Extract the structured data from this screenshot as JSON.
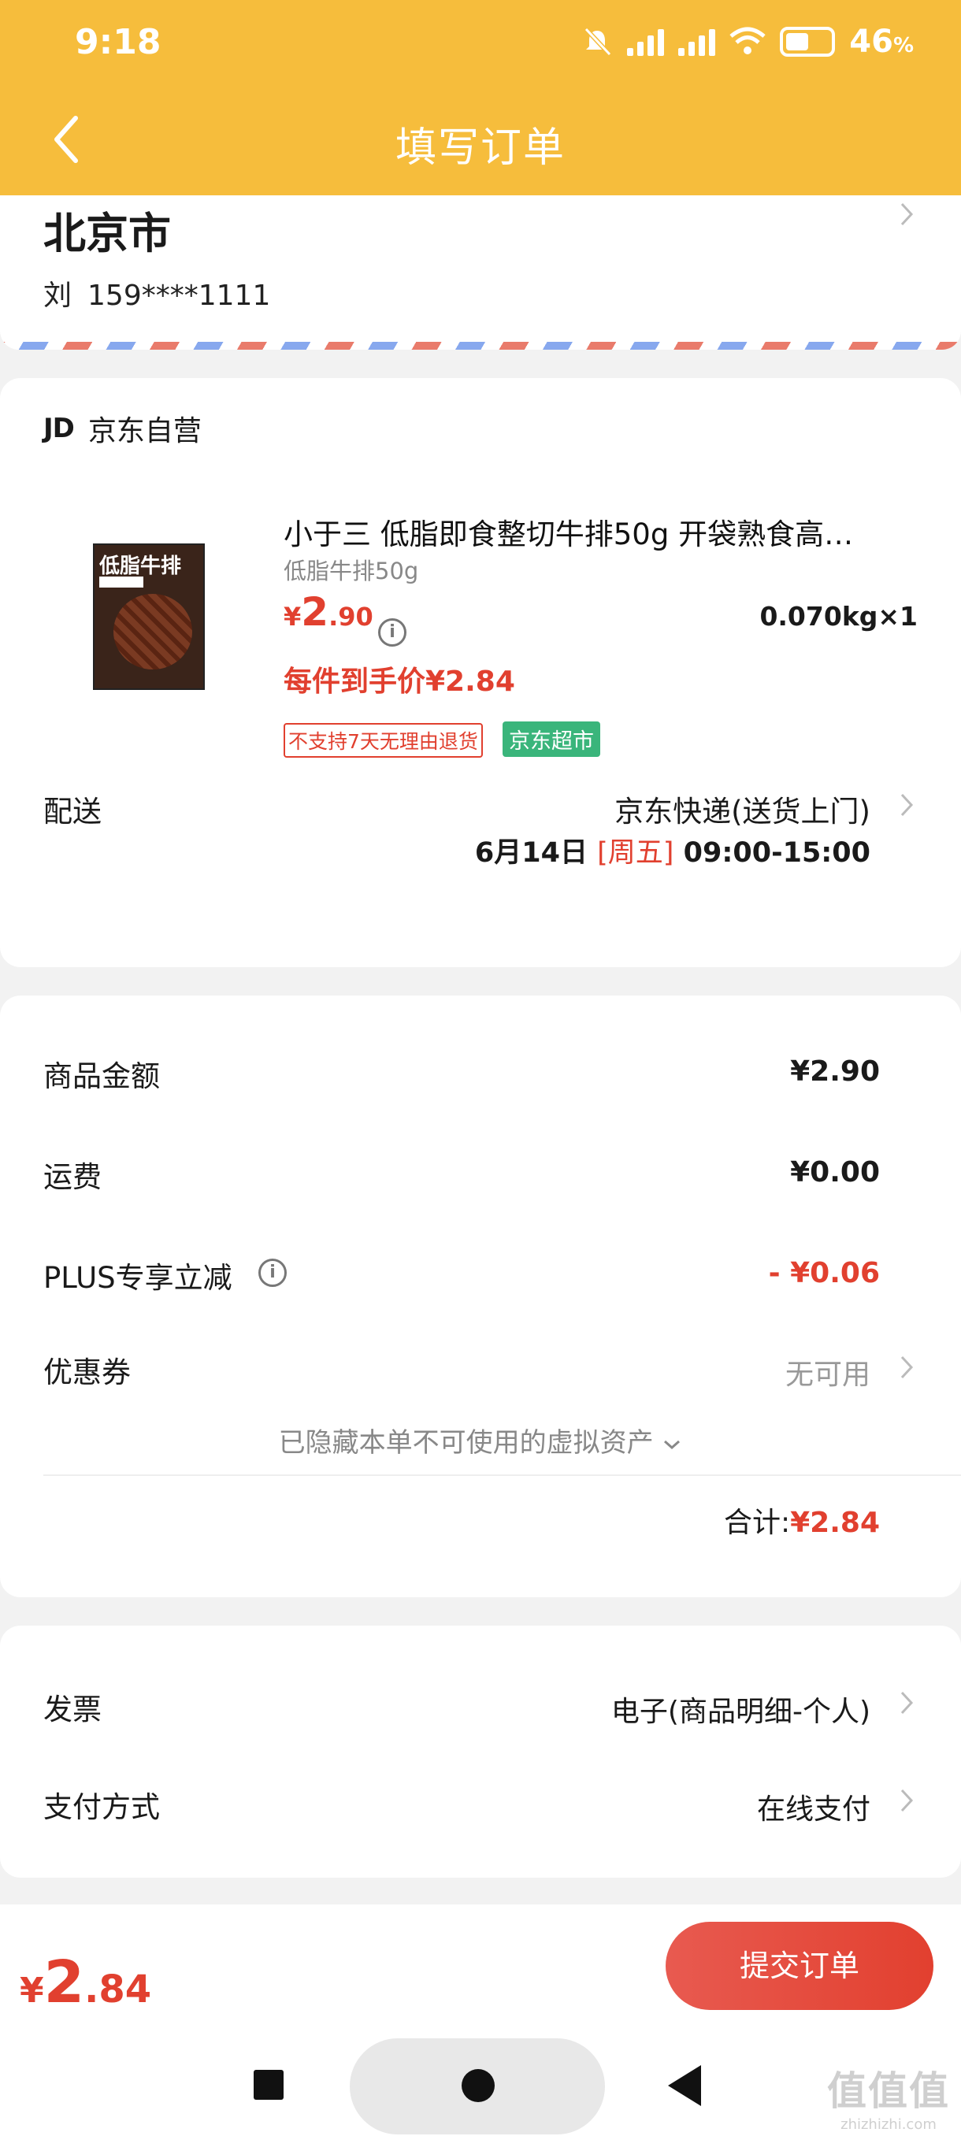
{
  "status_bar": {
    "time": "9:18",
    "battery": "46",
    "battery_unit": "%"
  },
  "nav": {
    "title": "填写订单"
  },
  "address": {
    "city": "北京市",
    "name": "刘",
    "phone": "159****1111"
  },
  "shop": {
    "logo": "JD",
    "name": "京东自营"
  },
  "product": {
    "title": "小于三 低脂即食整切牛排50g  开袋熟食高…",
    "spec": "低脂牛排50g",
    "price_currency": "¥",
    "price_int": "2",
    "price_dec": ".90",
    "weight_qty": "0.070kg×1",
    "hand_price": "每件到手价¥2.84",
    "badge_return": "不支持7天无理由退货",
    "badge_store": "京东超市",
    "thumb_text": "低脂牛排",
    "thumb_brand": "小于三"
  },
  "delivery": {
    "label": "配送",
    "method": "京东快递(送货上门)",
    "date": "6月14日",
    "weekday": "[周五]",
    "time": "09:00-15:00"
  },
  "summary": {
    "items": [
      {
        "label": "商品金额",
        "value": "¥2.90"
      },
      {
        "label": "运费",
        "value": "¥0.00"
      },
      {
        "label": "PLUS专享立减",
        "value": "- ¥0.06"
      },
      {
        "label": "优惠券",
        "value": "无可用"
      }
    ],
    "hidden_note": "已隐藏本单不可使用的虚拟资产",
    "total_label": "合计:",
    "total_value": "¥2.84"
  },
  "extras": {
    "invoice_label": "发票",
    "invoice_value": "电子(商品明细-个人)",
    "payment_label": "支付方式",
    "payment_value": "在线支付"
  },
  "bottom": {
    "price_currency": "¥",
    "price_int": "2",
    "price_dec": ".84",
    "submit": "提交订单"
  },
  "watermark": {
    "main": "值值值",
    "sub": "zhizhizhi.com"
  },
  "colors": {
    "header": "#f6bd3c",
    "accent_red": "#e1402f",
    "badge_green": "#3ab57b"
  }
}
